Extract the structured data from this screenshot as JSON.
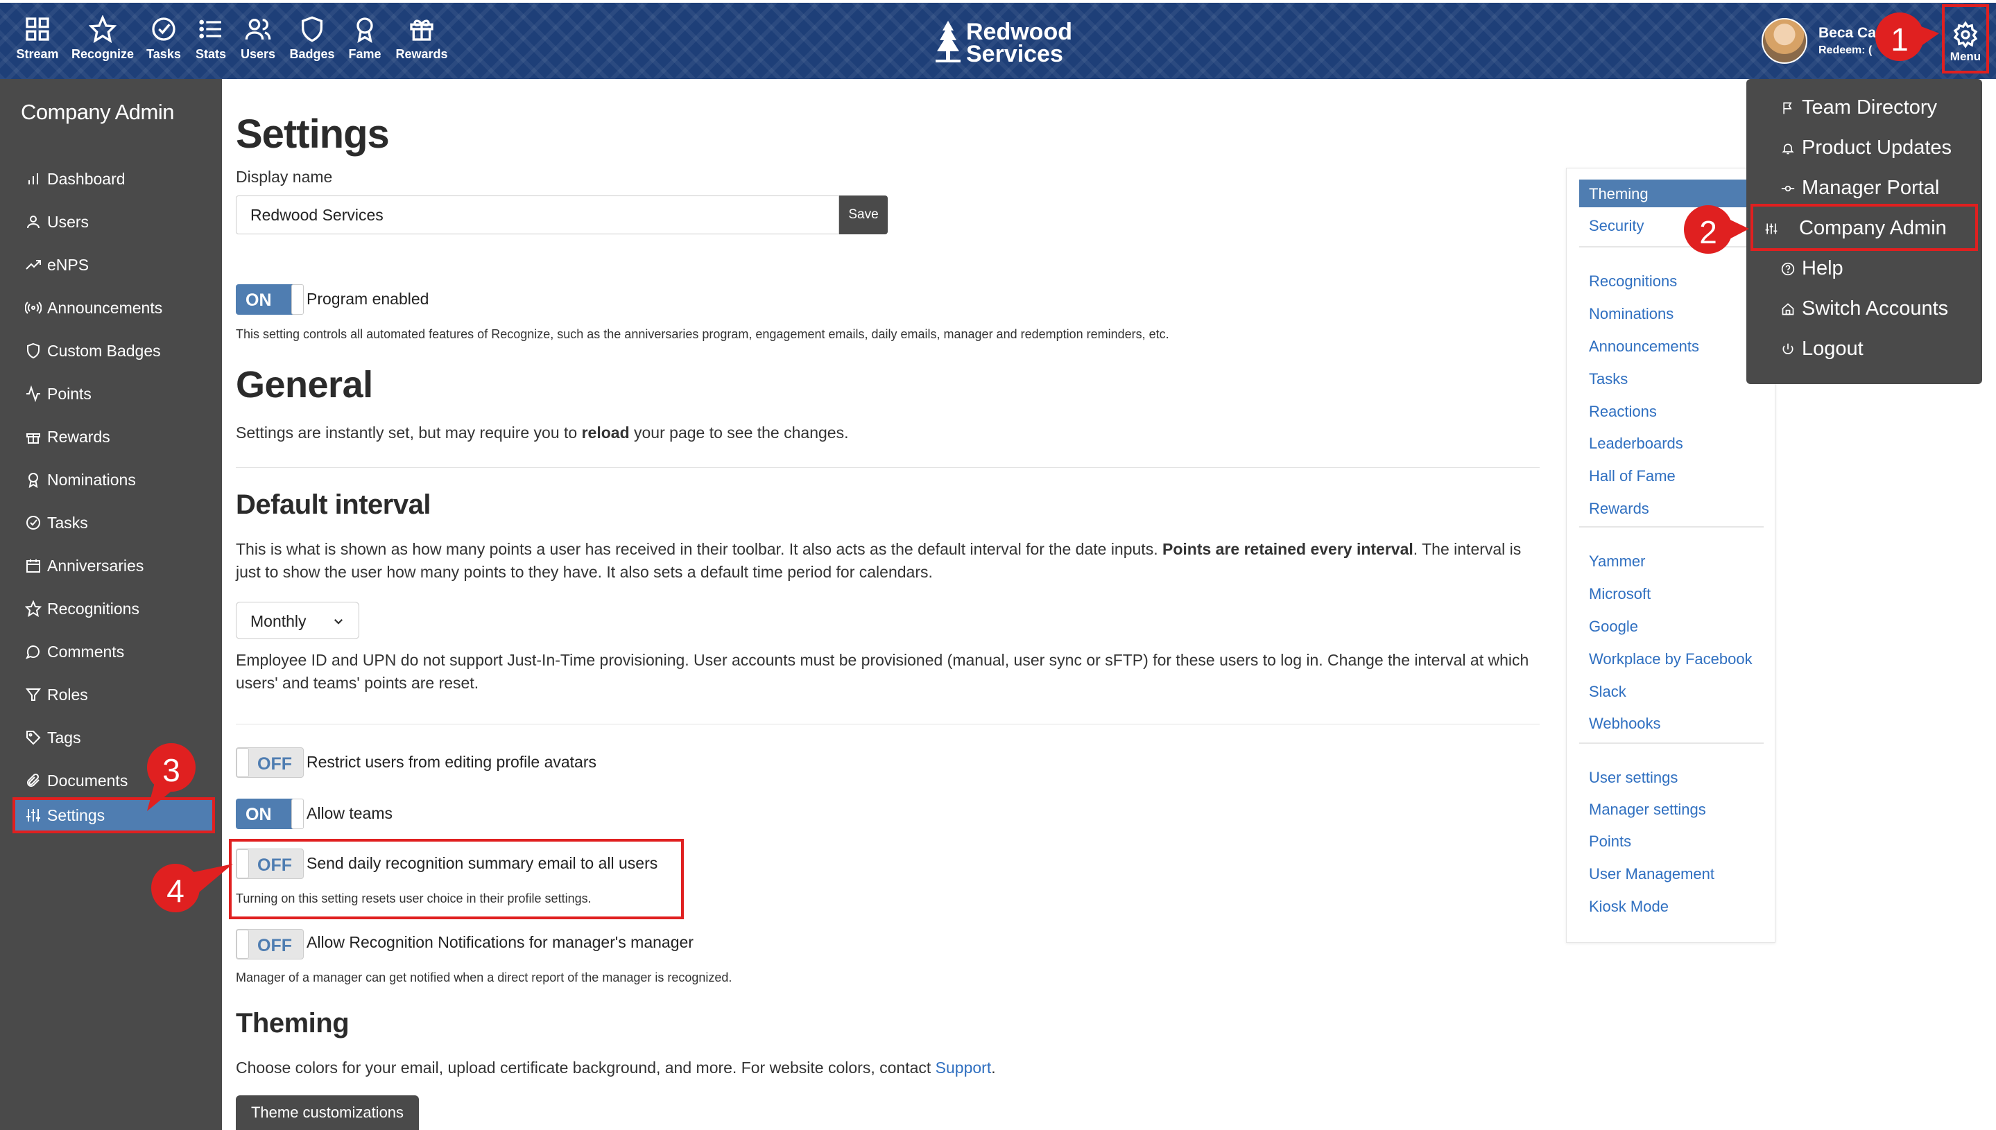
{
  "nav": [
    {
      "label": "Stream",
      "icon": "grid-icon"
    },
    {
      "label": "Recognize",
      "icon": "star-icon"
    },
    {
      "label": "Tasks",
      "icon": "check-circle-icon"
    },
    {
      "label": "Stats",
      "icon": "list-icon"
    },
    {
      "label": "Users",
      "icon": "users-icon"
    },
    {
      "label": "Badges",
      "icon": "shield-icon"
    },
    {
      "label": "Fame",
      "icon": "award-icon"
    },
    {
      "label": "Rewards",
      "icon": "gift-icon"
    }
  ],
  "brand": {
    "line1": "Redwood",
    "line2": "Services"
  },
  "profile": {
    "name": "Beca Ca",
    "redeem": "Redeem: ("
  },
  "menu_label": "Menu",
  "sidebar": {
    "title": "Company Admin",
    "items": [
      {
        "label": "Dashboard",
        "icon": "bar-chart-icon"
      },
      {
        "label": "Users",
        "icon": "user-icon"
      },
      {
        "label": "eNPS",
        "icon": "trend-icon"
      },
      {
        "label": "Announcements",
        "icon": "broadcast-icon"
      },
      {
        "label": "Custom Badges",
        "icon": "shield-icon"
      },
      {
        "label": "Points",
        "icon": "activity-icon"
      },
      {
        "label": "Rewards",
        "icon": "gift-icon"
      },
      {
        "label": "Nominations",
        "icon": "award-icon"
      },
      {
        "label": "Tasks",
        "icon": "check-circle-icon"
      },
      {
        "label": "Anniversaries",
        "icon": "calendar-icon"
      },
      {
        "label": "Recognitions",
        "icon": "star-icon"
      },
      {
        "label": "Comments",
        "icon": "comment-icon"
      },
      {
        "label": "Roles",
        "icon": "filter-icon"
      },
      {
        "label": "Tags",
        "icon": "tag-icon"
      },
      {
        "label": "Documents",
        "icon": "paperclip-icon"
      },
      {
        "label": "Settings",
        "icon": "sliders-icon"
      }
    ]
  },
  "main": {
    "title": "Settings",
    "display_name_label": "Display name",
    "display_name_value": "Redwood Services",
    "save_label": "Save",
    "program": {
      "state": "ON",
      "label": "Program enabled",
      "desc": "This setting controls all automated features of Recognize, such as the anniversaries program, engagement emails, daily emails, manager and redemption reminders, etc."
    },
    "general": {
      "title": "General",
      "desc_pre": "Settings are instantly set, but may require you to ",
      "desc_bold": "reload",
      "desc_post": " your page to see the changes."
    },
    "interval": {
      "title": "Default interval",
      "desc_pre": "This is what is shown as how many points a user has received in their toolbar. It also acts as the default interval for the date inputs. ",
      "desc_bold": "Points are retained every interval",
      "desc_post": ". The interval is just to show the user how many points to they have. It also sets a default time period for calendars.",
      "selected": "Monthly",
      "note": "Employee ID and UPN do not support Just-In-Time provisioning. User accounts must be provisioned (manual, user sync or sFTP) for these users to log in. Change the interval at which users' and teams' points are reset."
    },
    "toggles": [
      {
        "state": "OFF",
        "label": "Restrict users from editing profile avatars"
      },
      {
        "state": "ON",
        "label": "Allow teams"
      },
      {
        "state": "OFF",
        "label": "Send daily recognition summary email to all users",
        "desc": "Turning on this setting resets user choice in their profile settings."
      },
      {
        "state": "OFF",
        "label": "Allow Recognition Notifications for manager's manager",
        "desc": "Manager of a manager can get notified when a direct report of the manager is recognized."
      }
    ],
    "theming": {
      "title": "Theming",
      "desc_pre": "Choose colors for your email, upload certificate background, and more. For website colors, contact ",
      "link": "Support",
      "desc_post": ".",
      "button": "Theme customizations"
    }
  },
  "rightnav": {
    "group1": [
      "Theming",
      "Security"
    ],
    "group2": [
      "Recognitions",
      "Nominations",
      "Announcements",
      "Tasks",
      "Reactions",
      "Leaderboards",
      "Hall of Fame",
      "Rewards"
    ],
    "group3": [
      "Yammer",
      "Microsoft",
      "Google",
      "Workplace by Facebook",
      "Slack",
      "Webhooks"
    ],
    "group4": [
      "User settings",
      "Manager settings",
      "Points",
      "User Management",
      "Kiosk Mode"
    ]
  },
  "dropdown": [
    {
      "label": "Team Directory",
      "icon": "flag-icon"
    },
    {
      "label": "Product Updates",
      "icon": "bell-icon"
    },
    {
      "label": "Manager Portal",
      "icon": "commit-icon"
    },
    {
      "label": "Company Admin",
      "icon": "sliders-icon"
    },
    {
      "label": "Help",
      "icon": "help-circle-icon"
    },
    {
      "label": "Switch Accounts",
      "icon": "home-icon"
    },
    {
      "label": "Logout",
      "icon": "power-icon"
    }
  ],
  "callouts": [
    "1",
    "2",
    "3",
    "4"
  ],
  "colors": {
    "topbar": "#1e3f78",
    "sidebar": "#4a4a4a",
    "accent": "#4f7db1",
    "highlight": "#e02020",
    "link": "#2f6fc0"
  }
}
